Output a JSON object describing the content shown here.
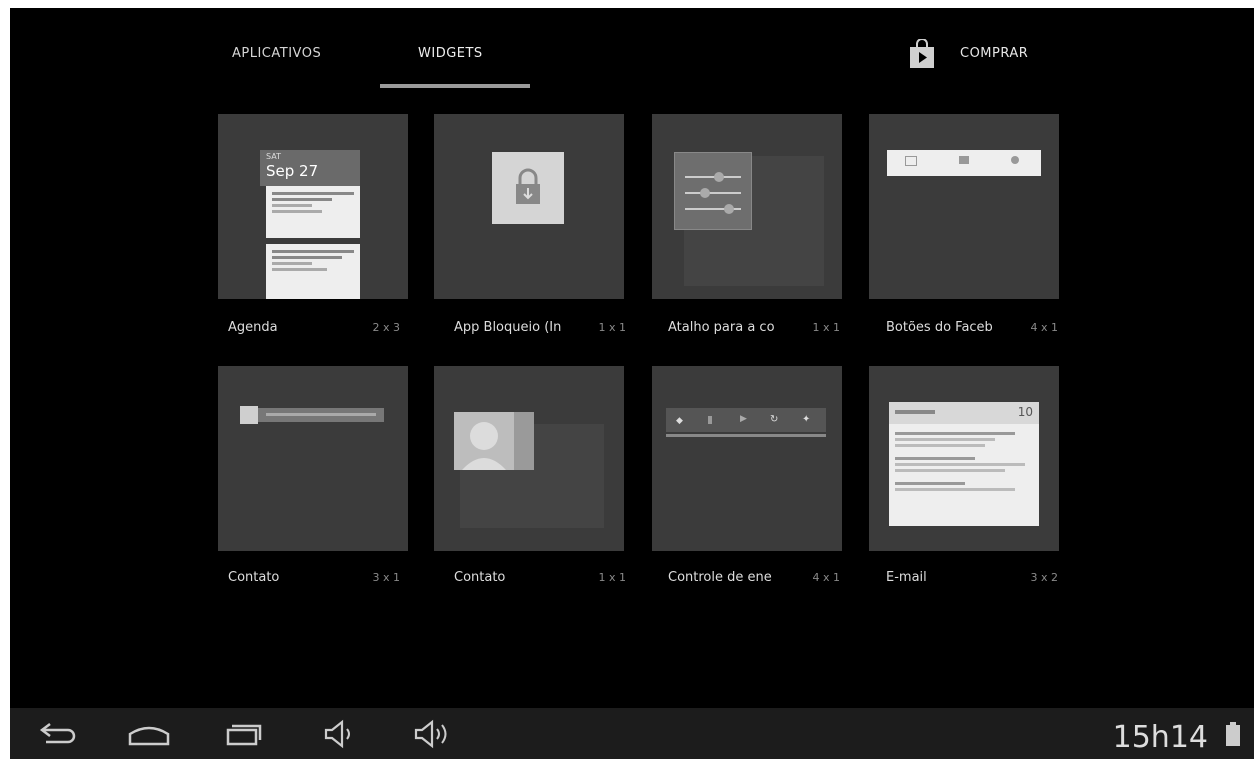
{
  "tabs": {
    "apps_label": "APLICATIVOS",
    "widgets_label": "WIDGETS",
    "store_label": "COMPRAR"
  },
  "widgets": [
    {
      "name": "Agenda",
      "size": "2 x 3",
      "preview": {
        "date_day": "SAT",
        "date": "Sep 27"
      }
    },
    {
      "name": "App Bloqueio (In",
      "size": "1 x 1"
    },
    {
      "name": "Atalho para a co",
      "size": "1 x 1"
    },
    {
      "name": "Botões do Faceb",
      "size": "4 x 1"
    },
    {
      "name": "Contato",
      "size": "3 x 1"
    },
    {
      "name": "Contato",
      "size": "1 x 1"
    },
    {
      "name": "Controle de ene",
      "size": "4 x 1"
    },
    {
      "name": "E-mail",
      "size": "3 x 2",
      "preview": {
        "count": "10"
      }
    }
  ],
  "statusbar": {
    "time": "15h14"
  },
  "colors": {
    "background": "#000000",
    "card": "#3b3b3b",
    "navbar": "#1c1c1c",
    "underline": "#9a9a9a"
  }
}
